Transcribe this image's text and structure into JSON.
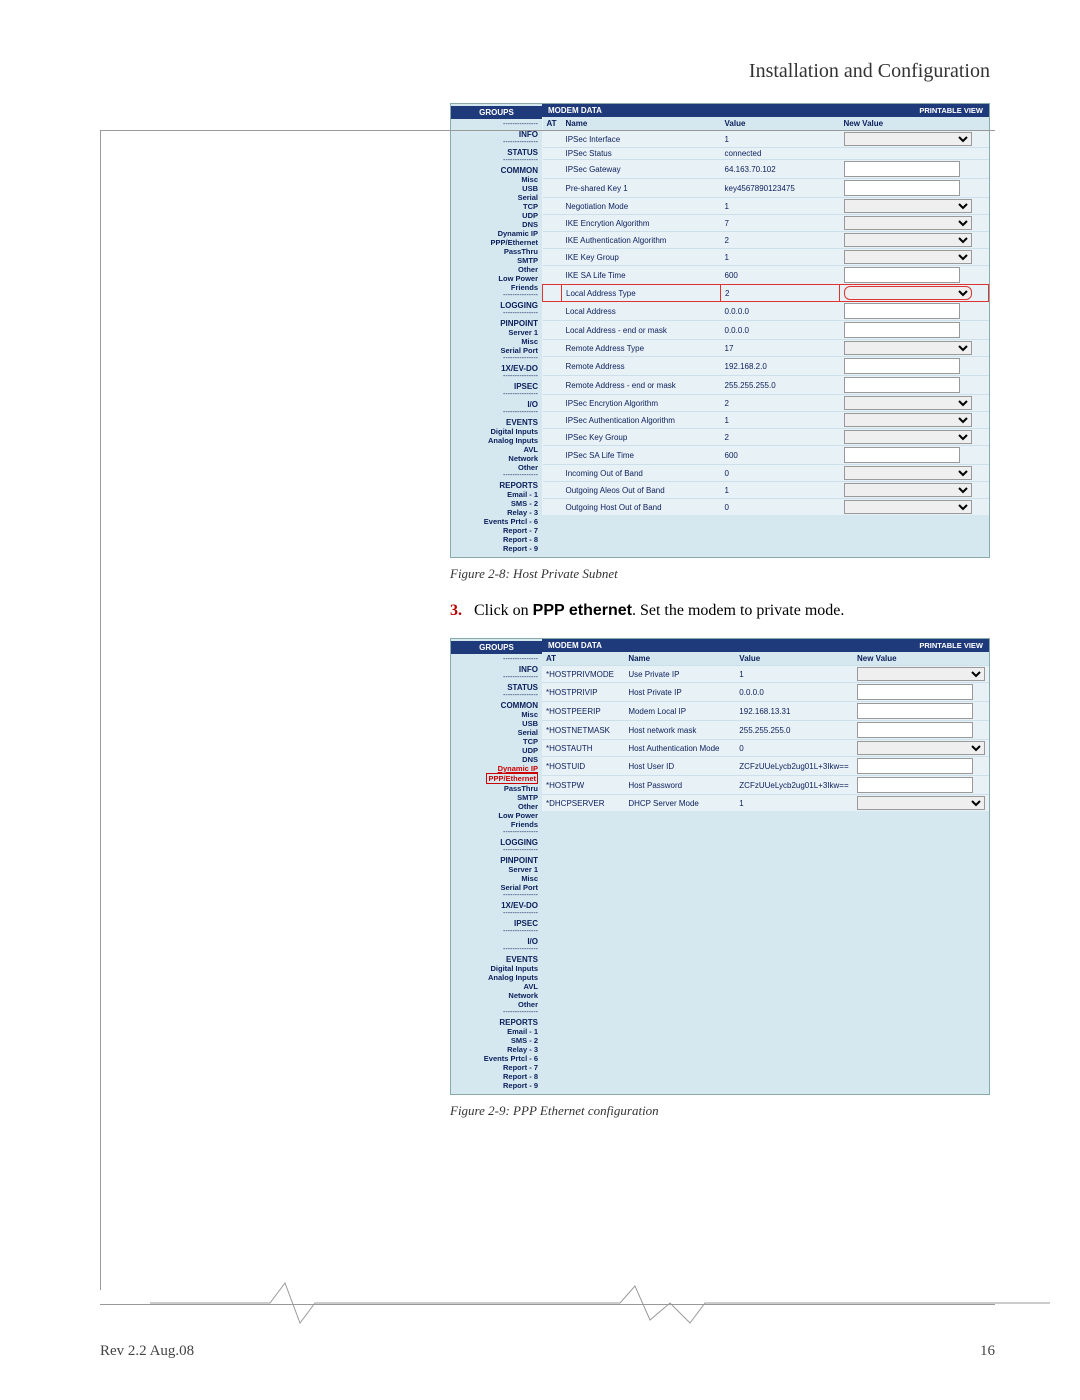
{
  "header": {
    "title": "Installation and Configuration"
  },
  "figure1": {
    "caption": "Figure 2-8: Host Private Subnet",
    "groups_label": "GROUPS",
    "modem_label": "MODEM DATA",
    "printable": "PRINTABLE VIEW",
    "col_at": "AT",
    "col_name": "Name",
    "col_value": "Value",
    "col_new": "New Value",
    "sidebar": [
      {
        "t": "dash"
      },
      {
        "t": "sec",
        "v": "INFO"
      },
      {
        "t": "dash"
      },
      {
        "t": "sec",
        "v": "STATUS"
      },
      {
        "t": "dash"
      },
      {
        "t": "sec",
        "v": "COMMON"
      },
      {
        "t": "sub",
        "v": "Misc"
      },
      {
        "t": "sub",
        "v": "USB"
      },
      {
        "t": "sub",
        "v": "Serial"
      },
      {
        "t": "sub",
        "v": "TCP"
      },
      {
        "t": "sub",
        "v": "UDP"
      },
      {
        "t": "sub",
        "v": "DNS"
      },
      {
        "t": "sub",
        "v": "Dynamic IP"
      },
      {
        "t": "sub",
        "v": "PPP/Ethernet"
      },
      {
        "t": "sub",
        "v": "PassThru"
      },
      {
        "t": "sub",
        "v": "SMTP"
      },
      {
        "t": "sub",
        "v": "Other"
      },
      {
        "t": "sub",
        "v": "Low Power"
      },
      {
        "t": "sub",
        "v": "Friends"
      },
      {
        "t": "dash"
      },
      {
        "t": "sec",
        "v": "LOGGING"
      },
      {
        "t": "dash"
      },
      {
        "t": "sec",
        "v": "PINPOINT"
      },
      {
        "t": "sub",
        "v": "Server 1"
      },
      {
        "t": "sub",
        "v": "Misc"
      },
      {
        "t": "sub",
        "v": "Serial Port"
      },
      {
        "t": "dash"
      },
      {
        "t": "sec",
        "v": "1X/EV-DO"
      },
      {
        "t": "dash"
      },
      {
        "t": "sec",
        "v": "IPSEC"
      },
      {
        "t": "dash"
      },
      {
        "t": "sec",
        "v": "I/O"
      },
      {
        "t": "dash"
      },
      {
        "t": "sec",
        "v": "EVENTS"
      },
      {
        "t": "sub",
        "v": "Digital Inputs"
      },
      {
        "t": "sub",
        "v": "Analog Inputs"
      },
      {
        "t": "sub",
        "v": "AVL"
      },
      {
        "t": "sub",
        "v": "Network"
      },
      {
        "t": "sub",
        "v": "Other"
      },
      {
        "t": "dash"
      },
      {
        "t": "sec",
        "v": "REPORTS"
      },
      {
        "t": "sub",
        "v": "Email - 1"
      },
      {
        "t": "sub",
        "v": "SMS - 2"
      },
      {
        "t": "sub",
        "v": "Relay - 3"
      },
      {
        "t": "sub",
        "v": "Events Prtcl - 6"
      },
      {
        "t": "sub",
        "v": "Report - 7"
      },
      {
        "t": "sub",
        "v": "Report - 8"
      },
      {
        "t": "sub",
        "v": "Report - 9"
      }
    ],
    "rows": [
      {
        "name": "IPSec Interface",
        "value": "1",
        "ctl": "select"
      },
      {
        "name": "IPSec Status",
        "value": "connected",
        "ctl": "none"
      },
      {
        "name": "IPSec Gateway",
        "value": "64.163.70.102",
        "ctl": "input"
      },
      {
        "name": "Pre-shared Key 1",
        "value": "key4567890123475",
        "ctl": "input"
      },
      {
        "name": "Negotiation Mode",
        "value": "1",
        "ctl": "select"
      },
      {
        "name": "IKE Encrytion Algorithm",
        "value": "7",
        "ctl": "select"
      },
      {
        "name": "IKE Authentication Algorithm",
        "value": "2",
        "ctl": "select"
      },
      {
        "name": "IKE Key Group",
        "value": "1",
        "ctl": "select"
      },
      {
        "name": "IKE SA Life Time",
        "value": "600",
        "ctl": "input"
      },
      {
        "name": "Local Address Type",
        "value": "2",
        "ctl": "select",
        "mark": true
      },
      {
        "name": "Local Address",
        "value": "0.0.0.0",
        "ctl": "input"
      },
      {
        "name": "Local Address - end or mask",
        "value": "0.0.0.0",
        "ctl": "input"
      },
      {
        "name": "Remote Address Type",
        "value": "17",
        "ctl": "select"
      },
      {
        "name": "Remote Address",
        "value": "192.168.2.0",
        "ctl": "input"
      },
      {
        "name": "Remote Address - end or mask",
        "value": "255.255.255.0",
        "ctl": "input"
      },
      {
        "name": "IPSec Encrytion Algorithm",
        "value": "2",
        "ctl": "select"
      },
      {
        "name": "IPSec Authentication Algorithm",
        "value": "1",
        "ctl": "select"
      },
      {
        "name": "IPSec Key Group",
        "value": "2",
        "ctl": "select"
      },
      {
        "name": "IPSec SA Life Time",
        "value": "600",
        "ctl": "input"
      },
      {
        "name": "Incoming Out of Band",
        "value": "0",
        "ctl": "select"
      },
      {
        "name": "Outgoing Aleos Out of Band",
        "value": "1",
        "ctl": "select"
      },
      {
        "name": "Outgoing Host Out of Band",
        "value": "0",
        "ctl": "select"
      }
    ]
  },
  "step": {
    "num": "3.",
    "pre": "Click on ",
    "bold": "PPP ethernet",
    "post": ". Set the modem to private mode."
  },
  "figure2": {
    "caption": "Figure 2-9: PPP Ethernet configuration",
    "groups_label": "GROUPS",
    "modem_label": "MODEM DATA",
    "printable": "PRINTABLE VIEW",
    "col_at": "AT",
    "col_name": "Name",
    "col_value": "Value",
    "col_new": "New Value",
    "sidebar": [
      {
        "t": "dash"
      },
      {
        "t": "sec",
        "v": "INFO"
      },
      {
        "t": "dash"
      },
      {
        "t": "sec",
        "v": "STATUS"
      },
      {
        "t": "dash"
      },
      {
        "t": "sec",
        "v": "COMMON"
      },
      {
        "t": "sub",
        "v": "Misc"
      },
      {
        "t": "sub",
        "v": "USB"
      },
      {
        "t": "sub",
        "v": "Serial"
      },
      {
        "t": "sub",
        "v": "TCP"
      },
      {
        "t": "sub",
        "v": "UDP"
      },
      {
        "t": "sub",
        "v": "DNS"
      },
      {
        "t": "hot",
        "v": "Dynamic IP"
      },
      {
        "t": "hot2",
        "v": "PPP/Ethernet"
      },
      {
        "t": "sub",
        "v": "PassThru"
      },
      {
        "t": "sub",
        "v": "SMTP"
      },
      {
        "t": "sub",
        "v": "Other"
      },
      {
        "t": "sub",
        "v": "Low Power"
      },
      {
        "t": "sub",
        "v": "Friends"
      },
      {
        "t": "dash"
      },
      {
        "t": "sec",
        "v": "LOGGING"
      },
      {
        "t": "dash"
      },
      {
        "t": "sec",
        "v": "PINPOINT"
      },
      {
        "t": "sub",
        "v": "Server 1"
      },
      {
        "t": "sub",
        "v": "Misc"
      },
      {
        "t": "sub",
        "v": "Serial Port"
      },
      {
        "t": "dash"
      },
      {
        "t": "sec",
        "v": "1X/EV-DO"
      },
      {
        "t": "dash"
      },
      {
        "t": "sec",
        "v": "IPSEC"
      },
      {
        "t": "dash"
      },
      {
        "t": "sec",
        "v": "I/O"
      },
      {
        "t": "dash"
      },
      {
        "t": "sec",
        "v": "EVENTS"
      },
      {
        "t": "sub",
        "v": "Digital Inputs"
      },
      {
        "t": "sub",
        "v": "Analog Inputs"
      },
      {
        "t": "sub",
        "v": "AVL"
      },
      {
        "t": "sub",
        "v": "Network"
      },
      {
        "t": "sub",
        "v": "Other"
      },
      {
        "t": "dash"
      },
      {
        "t": "sec",
        "v": "REPORTS"
      },
      {
        "t": "sub",
        "v": "Email - 1"
      },
      {
        "t": "sub",
        "v": "SMS - 2"
      },
      {
        "t": "sub",
        "v": "Relay - 3"
      },
      {
        "t": "sub",
        "v": "Events Prtcl - 6"
      },
      {
        "t": "sub",
        "v": "Report - 7"
      },
      {
        "t": "sub",
        "v": "Report - 8"
      },
      {
        "t": "sub",
        "v": "Report - 9"
      }
    ],
    "rows": [
      {
        "at": "*HOSTPRIVMODE",
        "name": "Use Private IP",
        "value": "1",
        "ctl": "select"
      },
      {
        "at": "*HOSTPRIVIP",
        "name": "Host Private IP",
        "value": "0.0.0.0",
        "ctl": "input"
      },
      {
        "at": "*HOSTPEERIP",
        "name": "Modem Local IP",
        "value": "192.168.13.31",
        "ctl": "input"
      },
      {
        "at": "*HOSTNETMASK",
        "name": "Host network mask",
        "value": "255.255.255.0",
        "ctl": "input"
      },
      {
        "at": "*HOSTAUTH",
        "name": "Host Authentication Mode",
        "value": "0",
        "ctl": "select"
      },
      {
        "at": "*HOSTUID",
        "name": "Host User ID",
        "value": "ZCFzUUeLycb2ug01L+3Ikw==",
        "ctl": "input"
      },
      {
        "at": "*HOSTPW",
        "name": "Host Password",
        "value": "ZCFzUUeLycb2ug01L+3Ikw==",
        "ctl": "input"
      },
      {
        "at": "*DHCPSERVER",
        "name": "DHCP Server Mode",
        "value": "1",
        "ctl": "select"
      }
    ]
  },
  "footer": {
    "left": "Rev 2.2  Aug.08",
    "right": "16"
  }
}
